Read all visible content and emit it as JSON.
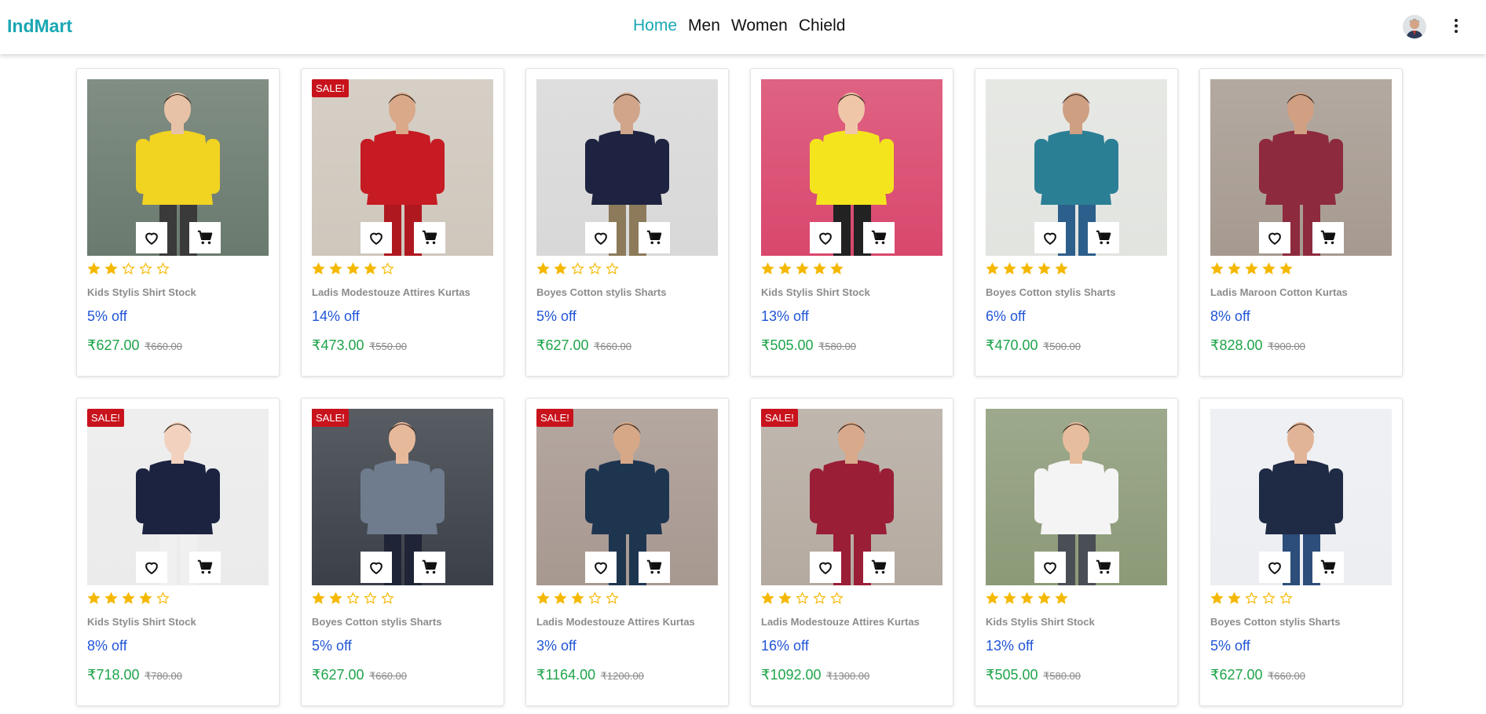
{
  "app": {
    "brand": "IndMart"
  },
  "nav": {
    "items": [
      "Home",
      "Men",
      "Women",
      "Chield"
    ],
    "active": "Home"
  },
  "colors": {
    "brand": "#1aa7b3",
    "discount": "#2055d6",
    "price": "#1ea44a",
    "sale_badge": "#c8131d",
    "star": "#f5b800"
  },
  "icons": {
    "heart": "heart-icon",
    "cart": "cart-icon",
    "menu": "kebab-menu-icon"
  },
  "products": [
    {
      "name": "Kids Stylis Shirt Stock",
      "rating": 2,
      "discount": "5% off",
      "price": "₹627.00",
      "mrp": "₹660.00",
      "sale": false,
      "badge": "",
      "bg": "#6a7a6e",
      "shirt": "#f1d321",
      "skin": "#e8c2a6",
      "pants": "#3a3a3a"
    },
    {
      "name": "Ladis Modestouze Attires Kurtas",
      "rating": 4,
      "discount": "14% off",
      "price": "₹473.00",
      "mrp": "₹550.00",
      "sale": true,
      "badge": "SALE!",
      "bg": "#cfc7bc",
      "shirt": "#c61b23",
      "skin": "#d9a98a",
      "pants": "#b01820"
    },
    {
      "name": "Boyes Cotton stylis Sharts",
      "rating": 2,
      "discount": "5% off",
      "price": "₹627.00",
      "mrp": "₹660.00",
      "sale": false,
      "badge": "",
      "bg": "#d8d8d8",
      "shirt": "#1d2340",
      "skin": "#d1a58a",
      "pants": "#8c7a5a"
    },
    {
      "name": "Kids Stylis Shirt Stock",
      "rating": 5,
      "discount": "13% off",
      "price": "₹505.00",
      "mrp": "₹580.00",
      "sale": false,
      "badge": "",
      "bg": "#d9476d",
      "shirt": "#f4e41e",
      "skin": "#efc7a8",
      "pants": "#222"
    },
    {
      "name": "Boyes Cotton stylis Sharts",
      "rating": 5,
      "discount": "6% off",
      "price": "₹470.00",
      "mrp": "₹500.00",
      "sale": false,
      "badge": "",
      "bg": "#e2e4e0",
      "shirt": "#2b7f95",
      "skin": "#cf9f82",
      "pants": "#2d5f8c"
    },
    {
      "name": "Ladis Maroon Cotton Kurtas",
      "rating": 5,
      "discount": "8% off",
      "price": "₹828.00",
      "mrp": "₹900.00",
      "sale": false,
      "badge": "",
      "bg": "#a69a90",
      "shirt": "#8e2a3d",
      "skin": "#d1a083",
      "pants": "#8e2a3d"
    },
    {
      "name": "Kids Stylis Shirt Stock",
      "rating": 4,
      "discount": "8% off",
      "price": "₹718.00",
      "mrp": "₹780.00",
      "sale": true,
      "badge": "SALE!",
      "bg": "#ebebeb",
      "shirt": "#1c2340",
      "skin": "#f2d2bf",
      "pants": "#f0f0f0"
    },
    {
      "name": "Boyes Cotton stylis Sharts",
      "rating": 2,
      "discount": "5% off",
      "price": "₹627.00",
      "mrp": "₹660.00",
      "sale": true,
      "badge": "SALE!",
      "bg": "#3b4048",
      "shirt": "#6f7c8e",
      "skin": "#e7b99b",
      "pants": "#1f2436"
    },
    {
      "name": "Ladis Modestouze Attires Kurtas",
      "rating": 3,
      "discount": "3% off",
      "price": "₹1164.00",
      "mrp": "₹1200.00",
      "sale": true,
      "badge": "SALE!",
      "bg": "#a79890",
      "shirt": "#1e3550",
      "skin": "#d6a888",
      "pants": "#1e3550"
    },
    {
      "name": "Ladis Modestouze Attires Kurtas",
      "rating": 2,
      "discount": "16% off",
      "price": "₹1092.00",
      "mrp": "₹1300.00",
      "sale": true,
      "badge": "SALE!",
      "bg": "#b4aaa0",
      "shirt": "#9a1e36",
      "skin": "#d8a98b",
      "pants": "#9a1e36"
    },
    {
      "name": "Kids Stylis Shirt Stock",
      "rating": 5,
      "discount": "13% off",
      "price": "₹505.00",
      "mrp": "₹580.00",
      "sale": false,
      "badge": "",
      "bg": "#8c9a78",
      "shirt": "#f4f4f4",
      "skin": "#e6bd9d",
      "pants": "#4a4e55"
    },
    {
      "name": "Boyes Cotton stylis Sharts",
      "rating": 2,
      "discount": "5% off",
      "price": "₹627.00",
      "mrp": "₹660.00",
      "sale": false,
      "badge": "",
      "bg": "#eceef2",
      "shirt": "#1f2a44",
      "skin": "#e2b497",
      "pants": "#2d4d7a"
    }
  ]
}
